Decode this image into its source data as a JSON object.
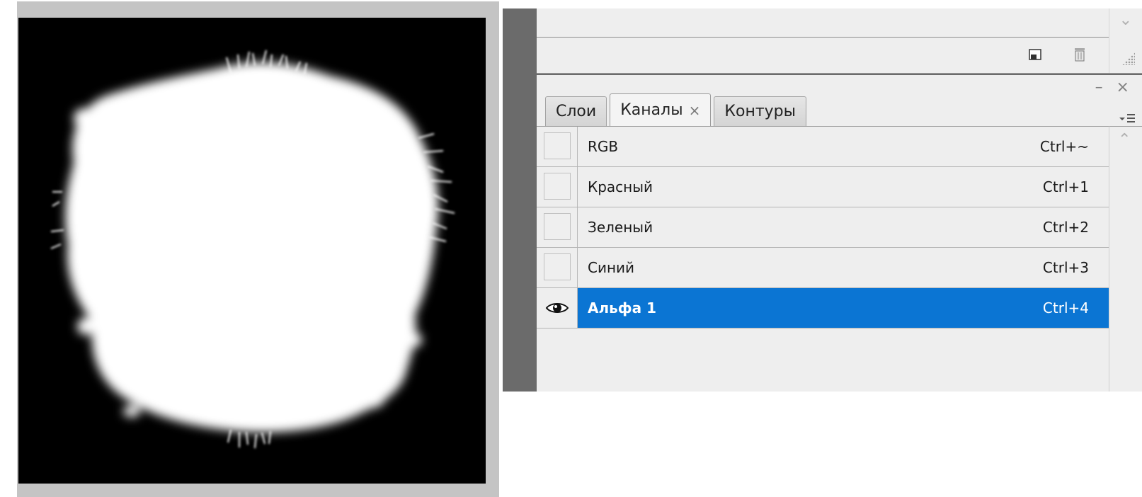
{
  "panel": {
    "tabs": [
      {
        "label": "Слои"
      },
      {
        "label": "Каналы",
        "close": "×"
      },
      {
        "label": "Контуры"
      }
    ],
    "controls": "– ×",
    "menu_icon": "panel-menu-icon"
  },
  "channels": [
    {
      "name": "RGB",
      "shortcut": "Ctrl+~",
      "visible": false
    },
    {
      "name": "Красный",
      "shortcut": "Ctrl+1",
      "visible": false
    },
    {
      "name": "Зеленый",
      "shortcut": "Ctrl+2",
      "visible": false
    },
    {
      "name": "Синий",
      "shortcut": "Ctrl+3",
      "visible": false
    },
    {
      "name": "Альфа 1",
      "shortcut": "Ctrl+4",
      "visible": true,
      "selected": true
    }
  ],
  "colors": {
    "selection": "#0b75d3",
    "panel_bg": "#eeeeee",
    "dock_bg": "#6b6b6b",
    "canvas_frame": "#c4c4c4"
  },
  "icons": [
    "new-channel-icon",
    "trash-icon",
    "resize-grip-icon",
    "eye-icon",
    "scroll-up-icon",
    "scroll-down-icon"
  ]
}
